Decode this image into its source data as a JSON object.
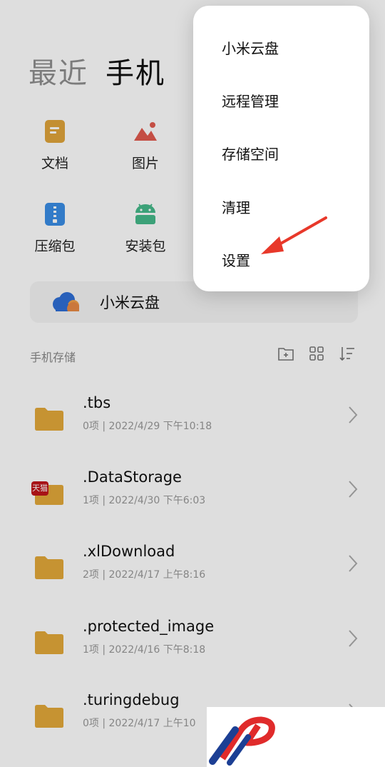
{
  "header": {
    "tabs": [
      {
        "label": "最近",
        "active": false
      },
      {
        "label": "手机",
        "active": true
      }
    ]
  },
  "categories": [
    {
      "label": "文档",
      "icon": "document-icon",
      "color": "#e0a53b"
    },
    {
      "label": "图片",
      "icon": "image-icon",
      "color": "#e25a4f"
    },
    {
      "label": "压缩包",
      "icon": "zip-icon",
      "color": "#3a8ee6"
    },
    {
      "label": "安装包",
      "icon": "android-icon",
      "color": "#46b98a"
    }
  ],
  "cloud": {
    "label": "小米云盘",
    "icon": "cloud-icon"
  },
  "storage": {
    "title": "手机存储",
    "tools": [
      "new-folder-icon",
      "grid-view-icon",
      "sort-icon"
    ]
  },
  "files": [
    {
      "name": ".tbs",
      "meta": "0项 | 2022/4/29 下午10:18",
      "badge": ""
    },
    {
      "name": ".DataStorage",
      "meta": "1项 | 2022/4/30 下午6:03",
      "badge": "天猫"
    },
    {
      "name": ".xlDownload",
      "meta": "2项 | 2022/4/17 上午8:16",
      "badge": ""
    },
    {
      "name": ".protected_image",
      "meta": "1项 | 2022/4/16 下午8:18",
      "badge": ""
    },
    {
      "name": ".turingdebug",
      "meta": "0项 | 2022/4/17 上午10",
      "badge": ""
    }
  ],
  "menu": {
    "items": [
      "小米云盘",
      "远程管理",
      "存储空间",
      "清理",
      "设置"
    ]
  },
  "colors": {
    "folder": "#e4a93a",
    "annotation_arrow": "#e8382a"
  }
}
